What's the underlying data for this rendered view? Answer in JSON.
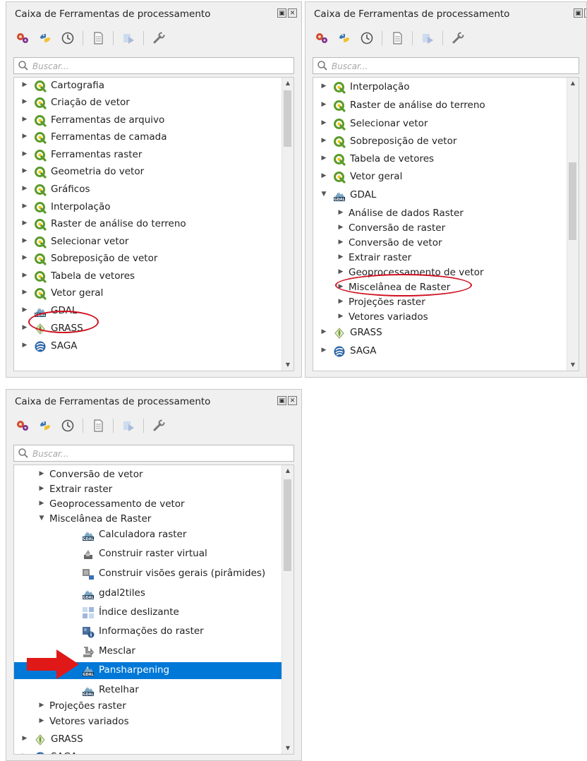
{
  "panels": [
    {
      "title": "Caixa de Ferramentas de processamento",
      "search_placeholder": "Buscar...",
      "items": [
        {
          "label": "Cartografia",
          "icon": "qgis-icon",
          "expanded": false
        },
        {
          "label": "Criação de vetor",
          "icon": "qgis-icon",
          "expanded": false
        },
        {
          "label": "Ferramentas de arquivo",
          "icon": "qgis-icon",
          "expanded": false
        },
        {
          "label": "Ferramentas de camada",
          "icon": "qgis-icon",
          "expanded": false
        },
        {
          "label": "Ferramentas raster",
          "icon": "qgis-icon",
          "expanded": false
        },
        {
          "label": "Geometria do vetor",
          "icon": "qgis-icon",
          "expanded": false
        },
        {
          "label": "Gráficos",
          "icon": "qgis-icon",
          "expanded": false
        },
        {
          "label": "Interpolação",
          "icon": "qgis-icon",
          "expanded": false
        },
        {
          "label": "Raster de análise do terreno",
          "icon": "qgis-icon",
          "expanded": false
        },
        {
          "label": "Selecionar vetor",
          "icon": "qgis-icon",
          "expanded": false
        },
        {
          "label": "Sobreposição de vetor",
          "icon": "qgis-icon",
          "expanded": false
        },
        {
          "label": "Tabela de vetores",
          "icon": "qgis-icon",
          "expanded": false
        },
        {
          "label": "Vetor geral",
          "icon": "qgis-icon",
          "expanded": false
        },
        {
          "label": "GDAL",
          "icon": "gdal-icon",
          "expanded": false,
          "highlighted": true
        },
        {
          "label": "GRASS",
          "icon": "grass-icon",
          "expanded": false
        },
        {
          "label": "SAGA",
          "icon": "saga-icon",
          "expanded": false
        }
      ]
    },
    {
      "title": "Caixa de Ferramentas de processamento",
      "search_placeholder": "Buscar...",
      "items": [
        {
          "label": "Interpolação",
          "icon": "qgis-icon",
          "expanded": false
        },
        {
          "label": "Raster de análise do terreno",
          "icon": "qgis-icon",
          "expanded": false
        },
        {
          "label": "Selecionar vetor",
          "icon": "qgis-icon",
          "expanded": false
        },
        {
          "label": "Sobreposição de vetor",
          "icon": "qgis-icon",
          "expanded": false
        },
        {
          "label": "Tabela de vetores",
          "icon": "qgis-icon",
          "expanded": false
        },
        {
          "label": "Vetor geral",
          "icon": "qgis-icon",
          "expanded": false
        },
        {
          "label": "GDAL",
          "icon": "gdal-icon",
          "expanded": true
        },
        {
          "label": "Análise de dados Raster",
          "level": 1,
          "expanded": false
        },
        {
          "label": "Conversão de raster",
          "level": 1,
          "expanded": false
        },
        {
          "label": "Conversão de vetor",
          "level": 1,
          "expanded": false
        },
        {
          "label": "Extrair raster",
          "level": 1,
          "expanded": false
        },
        {
          "label": "Geoprocessamento de vetor",
          "level": 1,
          "expanded": false
        },
        {
          "label": "Miscelânea de Raster",
          "level": 1,
          "expanded": false,
          "highlighted": true
        },
        {
          "label": "Projeções raster",
          "level": 1,
          "expanded": false
        },
        {
          "label": "Vetores variados",
          "level": 1,
          "expanded": false
        },
        {
          "label": "GRASS",
          "icon": "grass-icon",
          "expanded": false
        },
        {
          "label": "SAGA",
          "icon": "saga-icon",
          "expanded": false
        }
      ]
    },
    {
      "title": "Caixa de Ferramentas de processamento",
      "search_placeholder": "Buscar...",
      "items": [
        {
          "label": "Conversão de vetor",
          "level": 1,
          "expanded": false
        },
        {
          "label": "Extrair raster",
          "level": 1,
          "expanded": false
        },
        {
          "label": "Geoprocessamento de vetor",
          "level": 1,
          "expanded": false
        },
        {
          "label": "Miscelânea de Raster",
          "level": 1,
          "expanded": true
        },
        {
          "label": "Calculadora raster",
          "level": 2,
          "icon": "gdal-icon"
        },
        {
          "label": "Construir raster virtual",
          "level": 2,
          "icon": "virtual-raster-icon"
        },
        {
          "label": "Construir visões gerais (pirâmides)",
          "level": 2,
          "icon": "pyramid-icon"
        },
        {
          "label": "gdal2tiles",
          "level": 2,
          "icon": "gdal-icon"
        },
        {
          "label": "Índice deslizante",
          "level": 2,
          "icon": "tile-index-icon"
        },
        {
          "label": "Informações do raster",
          "level": 2,
          "icon": "raster-info-icon"
        },
        {
          "label": "Mesclar",
          "level": 2,
          "icon": "merge-icon"
        },
        {
          "label": "Pansharpening",
          "level": 2,
          "icon": "gdal-icon",
          "selected": true
        },
        {
          "label": "Retelhar",
          "level": 2,
          "icon": "gdal-icon"
        },
        {
          "label": "Projeções raster",
          "level": 1,
          "expanded": false
        },
        {
          "label": "Vetores variados",
          "level": 1,
          "expanded": false
        },
        {
          "label": "GRASS",
          "icon": "grass-icon",
          "expanded": false
        },
        {
          "label": "SAGA",
          "icon": "saga-icon",
          "expanded": false
        }
      ]
    }
  ],
  "toolbar_icons": [
    "models-icon",
    "python-icon",
    "history-icon",
    "results-icon",
    "edit-features-icon",
    "options-icon"
  ],
  "window_buttons": [
    "float-icon",
    "close-icon"
  ],
  "colors": {
    "selection": "#0078d7",
    "annotation": "#d01020",
    "qgis_green": "#5b9b2b"
  }
}
